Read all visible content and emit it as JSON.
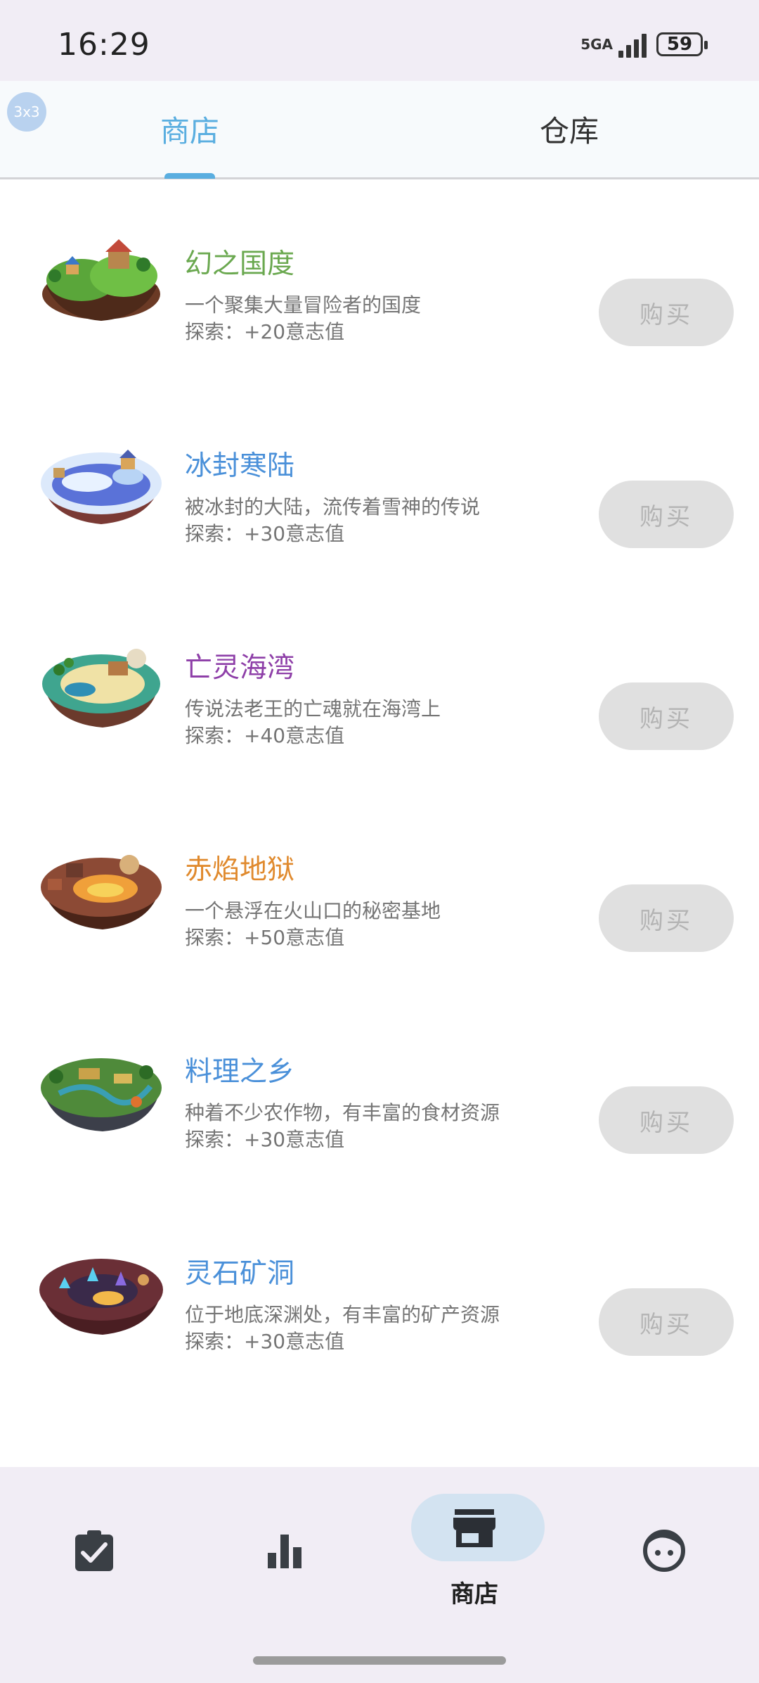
{
  "status_bar": {
    "time": "16:29",
    "network": "5GA",
    "battery": "59"
  },
  "badge": "3x3",
  "tabs": [
    {
      "label": "商店",
      "active": true
    },
    {
      "label": "仓库",
      "active": false
    }
  ],
  "items": [
    {
      "title": "幻之国度",
      "title_color": "#6aa84f",
      "desc": "一个聚集大量冒险者的国度",
      "explore": "探索：+20意志值",
      "button": "购买",
      "image": "green-island-image"
    },
    {
      "title": "冰封寒陆",
      "title_color": "#4a90d9",
      "desc": "被冰封的大陆，流传着雪神的传说",
      "explore": "探索：+30意志值",
      "button": "购买",
      "image": "ice-island-image"
    },
    {
      "title": "亡灵海湾",
      "title_color": "#8e3fa8",
      "desc": "传说法老王的亡魂就在海湾上",
      "explore": "探索：+40意志值",
      "button": "购买",
      "image": "desert-bay-image"
    },
    {
      "title": "赤焰地狱",
      "title_color": "#e08a2e",
      "desc": "一个悬浮在火山口的秘密基地",
      "explore": "探索：+50意志值",
      "button": "购买",
      "image": "volcano-island-image"
    },
    {
      "title": "料理之乡",
      "title_color": "#4a90d9",
      "desc": "种着不少农作物，有丰富的食材资源",
      "explore": "探索：+30意志值",
      "button": "购买",
      "image": "farm-island-image"
    },
    {
      "title": "灵石矿洞",
      "title_color": "#4a90d9",
      "desc": "位于地底深渊处，有丰富的矿产资源",
      "explore": "探索：+30意志值",
      "button": "购买",
      "image": "mine-cave-image"
    }
  ],
  "bottom_nav": [
    {
      "icon": "clipboard-check-icon",
      "label": "",
      "active": false
    },
    {
      "icon": "bar-chart-icon",
      "label": "",
      "active": false
    },
    {
      "icon": "store-icon",
      "label": "商店",
      "active": true
    },
    {
      "icon": "face-icon",
      "label": "",
      "active": false
    }
  ]
}
